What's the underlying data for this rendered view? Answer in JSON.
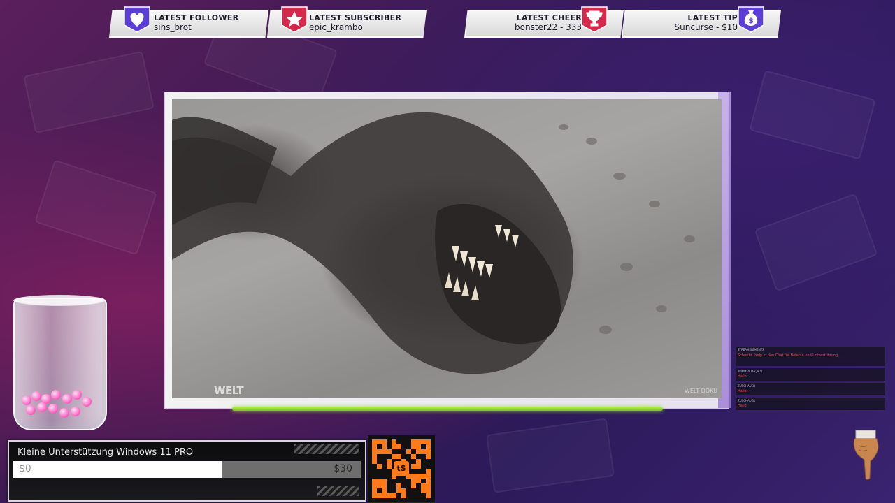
{
  "alerts": {
    "follower": {
      "title": "LATEST FOLLOWER",
      "value": "sins_brot"
    },
    "subscriber": {
      "title": "LATEST SUBSCRIBER",
      "value": "epic_krambo"
    },
    "cheer": {
      "title": "LATEST CHEER",
      "value": "bonster22 - 333"
    },
    "tip": {
      "title": "LATEST TIP",
      "value": "Suncurse - $10"
    }
  },
  "media": {
    "watermark": "WELT",
    "watermark_small": "WELT DOKU"
  },
  "goal": {
    "title": "Kleine Unterstützung Windows 11 PRO",
    "min_label": "$0",
    "max_label": "$30",
    "progress_fraction": 0.6
  },
  "qr": {
    "logo": "tS"
  },
  "chat": {
    "messages": [
      {
        "user": "STREAMELEMENTS",
        "text": "Schreibt !help in den Chat für Befehle und Unterstützung"
      },
      {
        "user": "KOMMENTAR_BOT",
        "text": "Hallo"
      },
      {
        "user": "ZUSCHAUER",
        "text": "Hallo"
      },
      {
        "user": "ZUSCHAUER",
        "text": "Hallo"
      }
    ]
  },
  "colors": {
    "follower_badge": "#5b3fd6",
    "subscriber_badge": "#d6284a",
    "cheer_badge": "#d6284a",
    "tip_badge": "#5b3fd6",
    "progress_line": "#8fd42a"
  }
}
